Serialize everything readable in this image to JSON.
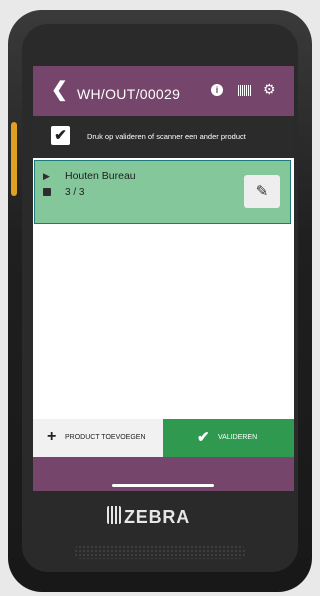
{
  "header": {
    "back_icon": "chevron-left-icon",
    "title": "WH/OUT/00029",
    "info_icon": "info-icon",
    "barcode_icon": "barcode-icon",
    "settings_icon": "gear-icon"
  },
  "scan_bar": {
    "checked": true,
    "text": "Druk op valideren of scanner een ander product"
  },
  "product": {
    "tag_icon": "tag-icon",
    "name": "Houten Bureau",
    "box_icon": "box-icon",
    "quantity": "3 / 3",
    "edit_icon": "pencil-icon",
    "highlight_color": "#83c79a"
  },
  "actions": {
    "add_product_label": "PRODUCT TOEVOEGEN",
    "validate_label": "VALIDEREN",
    "validate_color": "#2f9a4f"
  },
  "theme": {
    "primary": "#76456b"
  },
  "device": {
    "brand": "ZEBRA"
  }
}
